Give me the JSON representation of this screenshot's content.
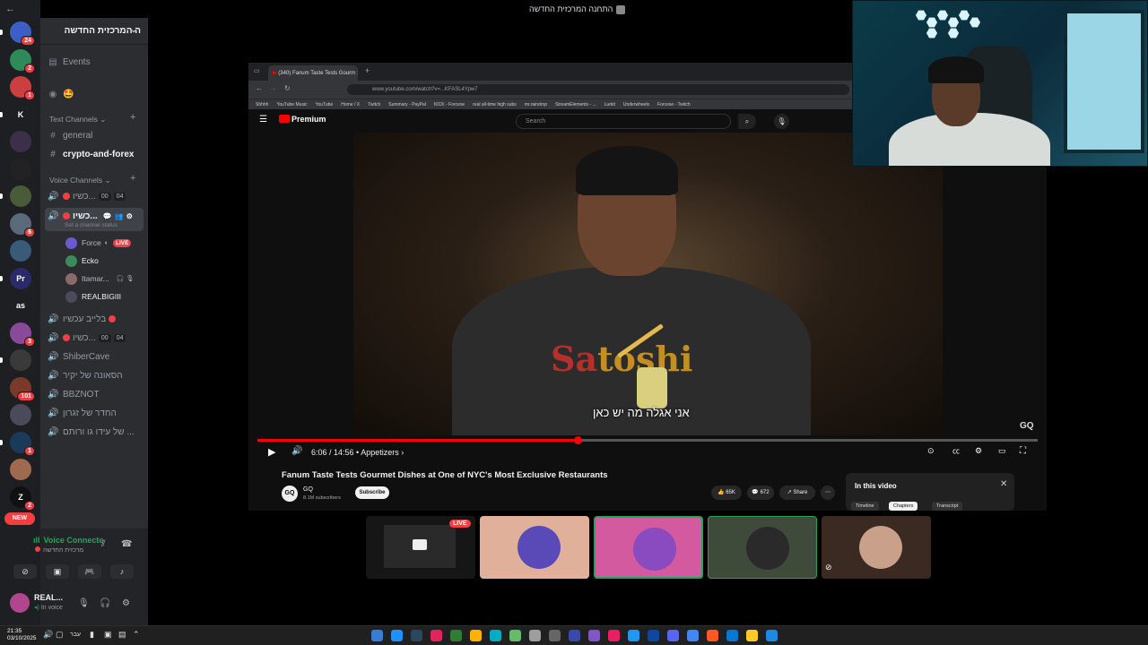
{
  "window": {
    "title": "התחנה המרכזית החדשה"
  },
  "rail": {
    "servers": [
      {
        "label": "",
        "badge": "24",
        "color": "#3b5fc6"
      },
      {
        "label": "",
        "badge": "2",
        "color": "#2f8a5a"
      },
      {
        "label": "",
        "badge": "1",
        "color": "#cc3f3f"
      },
      {
        "label": "K",
        "badge": "",
        "color": "#1e1f22"
      },
      {
        "label": "",
        "badge": "",
        "color": "#3b2f4a"
      },
      {
        "label": "",
        "badge": "",
        "color": "#222"
      },
      {
        "label": "",
        "badge": "",
        "color": "#4a5b3a"
      },
      {
        "label": "",
        "badge": "6",
        "color": "#5a6a7a"
      },
      {
        "label": "",
        "badge": "",
        "color": "#3a5a7a"
      },
      {
        "label": "Pr",
        "badge": "",
        "color": "#2a2a6a"
      },
      {
        "label": "as",
        "badge": "",
        "color": "#1e1f22"
      },
      {
        "label": "",
        "badge": "3",
        "color": "#8a4a9a"
      },
      {
        "label": "",
        "badge": "",
        "color": "#3a3a3a"
      },
      {
        "label": "",
        "badge": "101",
        "color": "#7a3a2a"
      },
      {
        "label": "",
        "badge": "",
        "color": "#4a4a5a"
      },
      {
        "label": "",
        "badge": "1",
        "color": "#1a3a5a"
      },
      {
        "label": "",
        "badge": "",
        "color": "#a06a50"
      },
      {
        "label": "Z",
        "badge": "2",
        "color": "#111"
      }
    ],
    "new_label": "NEW"
  },
  "sidebar": {
    "server_name": "ה המרכזית החדשה",
    "events": "Events",
    "emoji_row": "🤩",
    "text_category": "Text Channels",
    "text_channels": [
      "general",
      "crypto-and-forex"
    ],
    "voice_category": "Voice Channels",
    "voice_channels": [
      {
        "name": "כשיו...",
        "counter_a": "00",
        "counter_b": "04"
      },
      {
        "name": "כשיו...",
        "active": true
      },
      {
        "name": "בלייב עכשיו"
      },
      {
        "name": "כשיו...",
        "counter_a": "00",
        "counter_b": "04"
      },
      {
        "name": "ShiberCave"
      },
      {
        "name": "הסאונה של יקיר"
      },
      {
        "name": "BBZNOT"
      },
      {
        "name": "החדר של זגרון"
      },
      {
        "name": "של עידו גו ורותם ..."
      }
    ],
    "channel_status_hint": "Set a channel status",
    "members": [
      {
        "name": "Force",
        "live": "LIVE"
      },
      {
        "name": "Ecko"
      },
      {
        "name": "Itamar..."
      },
      {
        "name": "REALBIGIII"
      }
    ]
  },
  "voice_panel": {
    "connected": "Voice Connecte",
    "channel": "מרכזית החדשה",
    "username": "REAL...",
    "user_status": "In voice"
  },
  "browser": {
    "tab_title": "(340) Fanum Taste Tests Gourm",
    "url": "www.youtube.com/watch?v=...KFASL4Ypw7",
    "bookmarks": [
      "Shhhh",
      "YouTube Music",
      "YouTube",
      "Home / X",
      "Twitch",
      "Summary - PayPal",
      "KICK - Forcese",
      "real all-time high subs",
      "mr.raindrop",
      "StreamElements - ...",
      "Lurkit",
      "Underwheels",
      "Forcese - Twitch"
    ],
    "yt_brand": "Premium",
    "search_placeholder": "Search"
  },
  "video": {
    "subtitle": "אני אגלה מה יש כאן",
    "watermark": "GQ",
    "shirt_text_a": "Sa",
    "shirt_text_b": "toshi",
    "progress": 0.41,
    "time": "6:06 / 14:56",
    "chapter": "Appetizers ›",
    "title": "Fanum Taste Tests Gourmet Dishes at One of NYC's Most Exclusive Restaurants",
    "channel": "GQ",
    "subscribers": "8.1M subscribers",
    "subscribe_label": "Subscribe",
    "likes": "65K",
    "comments": "672",
    "share": "Share",
    "in_this_video": "In this video",
    "chips": [
      "Timeline",
      "Chapters",
      "Transcript"
    ]
  },
  "tiles": {
    "live_label": "LIVE"
  },
  "taskbar": {
    "time": "21:35",
    "date": "03/10/2025",
    "lang": "עבר"
  }
}
